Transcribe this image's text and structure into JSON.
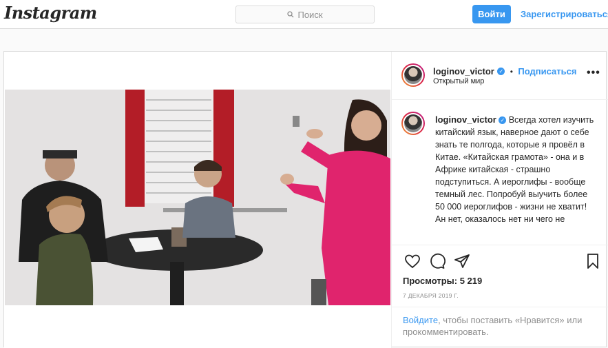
{
  "header": {
    "logo": "Instagram",
    "search_placeholder": "Поиск",
    "login_button": "Войти",
    "signup_link": "Зарегистрироваться"
  },
  "post": {
    "username": "loginov_victor",
    "verified_mark": "✓",
    "separator": "•",
    "follow_label": "Подписаться",
    "location": "Открытый мир",
    "more_label": "•••",
    "caption": "Всегда хотел изучить китайский язык, наверное дают о себе знать те полгода, которые я провёл в Китае. «Китайская грамота» - она и в Африке китайская - страшно подступиться. А иероглифы - вообще темный лес. Попробуй выучить более 50 000 иероглифов - жизни не хватит! Ан нет, оказалось нет ни чего не",
    "views": "Просмотры: 5 219",
    "date": "7 ДЕКАБРЯ 2019 Г.",
    "login_prompt_link": "Войдите",
    "login_prompt_rest": ", чтобы поставить «Нравится» или прокомментировать."
  },
  "icons": [
    "search-icon",
    "verified-icon",
    "more-icon",
    "heart-icon",
    "comment-icon",
    "share-icon",
    "bookmark-icon"
  ],
  "colors": {
    "accent": "#3897f0",
    "border": "#dbdbdb",
    "text": "#262626",
    "muted": "#8e8e8e"
  }
}
